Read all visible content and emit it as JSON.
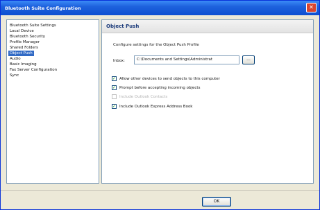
{
  "window": {
    "title": "Bluetooth Suite Configuration",
    "close_symbol": "✕"
  },
  "sidebar": {
    "items": [
      {
        "label": "Bluetooth Suite Settings",
        "selected": false
      },
      {
        "label": "Local Device",
        "selected": false
      },
      {
        "label": "Bluetooth Security",
        "selected": false
      },
      {
        "label": "Profile Manager",
        "selected": false
      },
      {
        "label": "Shared Folders",
        "selected": false
      },
      {
        "label": "Object Push",
        "selected": true
      },
      {
        "label": "Audio",
        "selected": false
      },
      {
        "label": "Basic Imaging",
        "selected": false
      },
      {
        "label": "Fax Server Configuration",
        "selected": false
      },
      {
        "label": "Sync",
        "selected": false
      }
    ]
  },
  "panel": {
    "title": "Object Push",
    "description": "Configure settings for the Object Push Profile",
    "directory_label": "Inbox:",
    "directory_value": "C:\\Documents and Settings\\Administrat",
    "browse_label": "...",
    "options": [
      {
        "label": "Allow other devices to send objects to this computer",
        "checked": true,
        "disabled": false
      },
      {
        "label": "Prompt before accepting incoming objects",
        "checked": true,
        "disabled": false
      },
      {
        "label": "Include Outlook Contacts",
        "checked": false,
        "disabled": true
      },
      {
        "label": "Include Outlook Express Address Book",
        "checked": true,
        "disabled": false
      }
    ]
  },
  "footer": {
    "ok_label": "OK"
  }
}
